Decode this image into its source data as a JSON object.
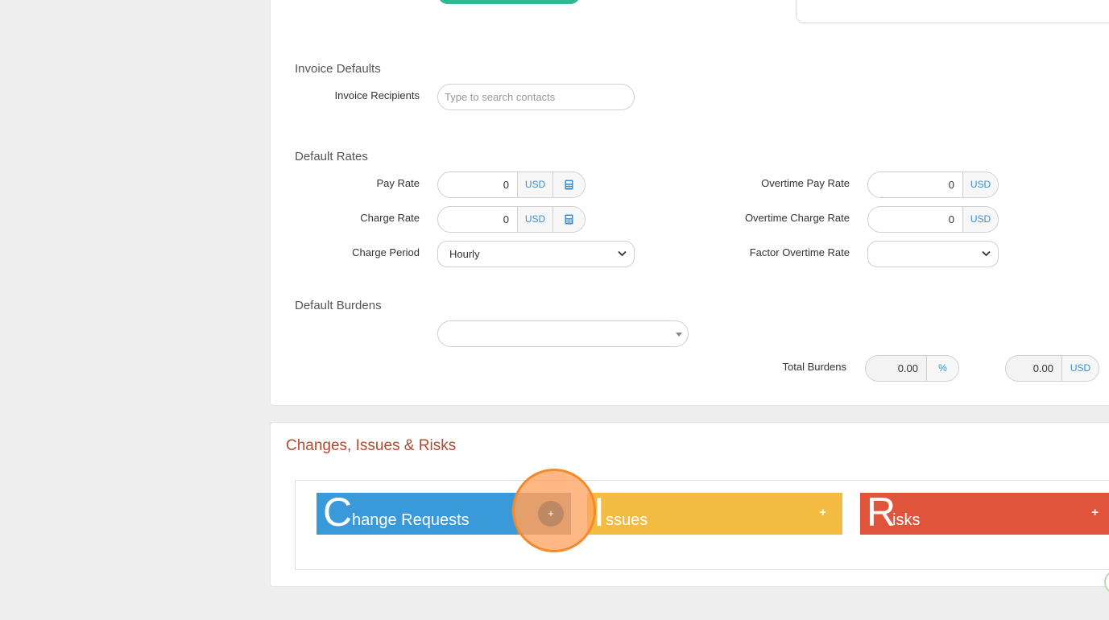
{
  "invoice_defaults": {
    "title": "Invoice Defaults",
    "recipients_label": "Invoice Recipients",
    "recipients_placeholder": "Type to search contacts"
  },
  "default_rates": {
    "title": "Default Rates",
    "pay_rate": {
      "label": "Pay Rate",
      "value": "0",
      "currency": "USD"
    },
    "charge_rate": {
      "label": "Charge Rate",
      "value": "0",
      "currency": "USD"
    },
    "charge_period": {
      "label": "Charge Period",
      "value": "Hourly"
    },
    "overtime_pay_rate": {
      "label": "Overtime Pay Rate",
      "value": "0",
      "currency": "USD"
    },
    "overtime_charge_rate": {
      "label": "Overtime Charge Rate",
      "value": "0",
      "currency": "USD"
    },
    "factor_overtime_rate": {
      "label": "Factor Overtime Rate",
      "value": ""
    }
  },
  "default_burdens": {
    "title": "Default Burdens",
    "total_label": "Total Burdens",
    "total_percent": "0.00",
    "percent_symbol": "%",
    "total_amount": "0.00",
    "amount_currency": "USD"
  },
  "changes_issues_risks": {
    "title": "Changes, Issues & Risks",
    "tiles": [
      {
        "initial": "C",
        "rest": "hange Requests",
        "plus": "+",
        "color": "#3a9ad9"
      },
      {
        "initial": "I",
        "rest": "ssues",
        "plus": "+",
        "color": "#f4bb42"
      },
      {
        "initial": "R",
        "rest": "isks",
        "plus": "+",
        "color": "#e0543c"
      }
    ],
    "cursor_plus": "+"
  },
  "icons": [
    "calculator-icon",
    "chevron-down-icon",
    "caret-down-icon",
    "plus-icon"
  ],
  "colors": {
    "accent_green": "#2fb991",
    "heading_red": "#b04a32",
    "highlight_orange": "#f28b2c",
    "link_blue": "#3a8fd0"
  }
}
